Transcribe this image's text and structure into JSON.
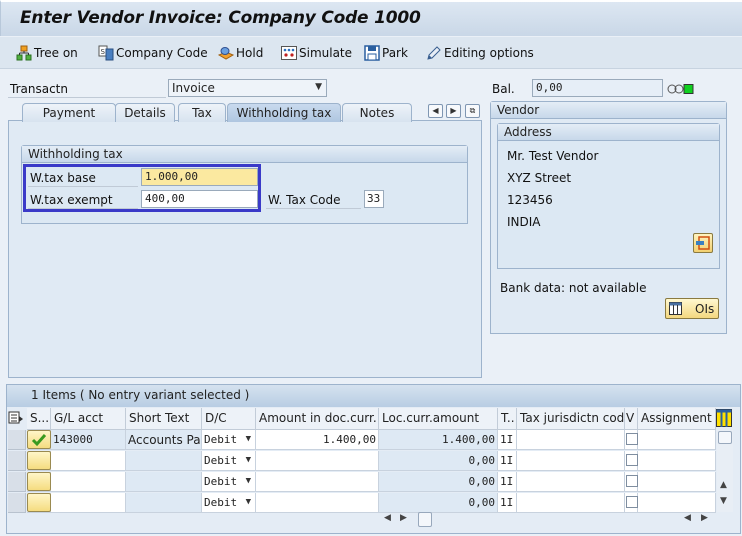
{
  "window": {
    "title": "Enter Vendor Invoice: Company Code 1000"
  },
  "toolbar": [
    {
      "label": "Tree on",
      "icon": "tree-icon"
    },
    {
      "label": "Company Code",
      "icon": "company-code-icon"
    },
    {
      "label": "Hold",
      "icon": "hold-icon"
    },
    {
      "label": "Simulate",
      "icon": "simulate-icon"
    },
    {
      "label": "Park",
      "icon": "save-icon"
    },
    {
      "label": "Editing options",
      "icon": "pencil-icon"
    }
  ],
  "header": {
    "transaction_label": "Transactn",
    "transaction_value": "Invoice",
    "balance_label": "Bal.",
    "balance_value": "0,00",
    "status_light": "green"
  },
  "tabs": [
    {
      "label": "Payment",
      "active": false
    },
    {
      "label": "Details",
      "active": false
    },
    {
      "label": "Tax",
      "active": false
    },
    {
      "label": "Withholding tax",
      "active": true
    },
    {
      "label": "Notes",
      "active": false
    }
  ],
  "withholding": {
    "group_title": "Withholding tax",
    "base_label": "W.tax base",
    "base_value": "1.000,00",
    "exempt_label": "W.tax exempt",
    "exempt_value": "400,00",
    "code_label": "W. Tax Code",
    "code_value": "33"
  },
  "vendor": {
    "title": "Vendor",
    "address_title": "Address",
    "address_lines": [
      "Mr. Test Vendor",
      "XYZ Street",
      "123456",
      "INDIA"
    ],
    "bank_data": "Bank data: not available",
    "ois_button": "OIs"
  },
  "items": {
    "header": "1 Items ( No entry variant selected )",
    "columns": [
      "S...",
      "G/L acct",
      "Short Text",
      "D/C",
      "Amount in doc.curr.",
      "Loc.curr.amount",
      "T..",
      "Tax jurisdictn code",
      "V",
      "Assignment n"
    ],
    "rows": [
      {
        "status": "ok",
        "gl": "143000",
        "text": "Accounts Pa...",
        "dc": "Debit",
        "amount": "1.400,00",
        "loc": "1.400,00",
        "tax": "1I",
        "jur": "",
        "assign": ""
      },
      {
        "status": "",
        "gl": "",
        "text": "",
        "dc": "Debit",
        "amount": "",
        "loc": "0,00",
        "tax": "1I",
        "jur": "",
        "assign": ""
      },
      {
        "status": "",
        "gl": "",
        "text": "",
        "dc": "Debit",
        "amount": "",
        "loc": "0,00",
        "tax": "1I",
        "jur": "",
        "assign": ""
      },
      {
        "status": "",
        "gl": "",
        "text": "",
        "dc": "Debit",
        "amount": "",
        "loc": "0,00",
        "tax": "1I",
        "jur": "",
        "assign": ""
      }
    ]
  }
}
